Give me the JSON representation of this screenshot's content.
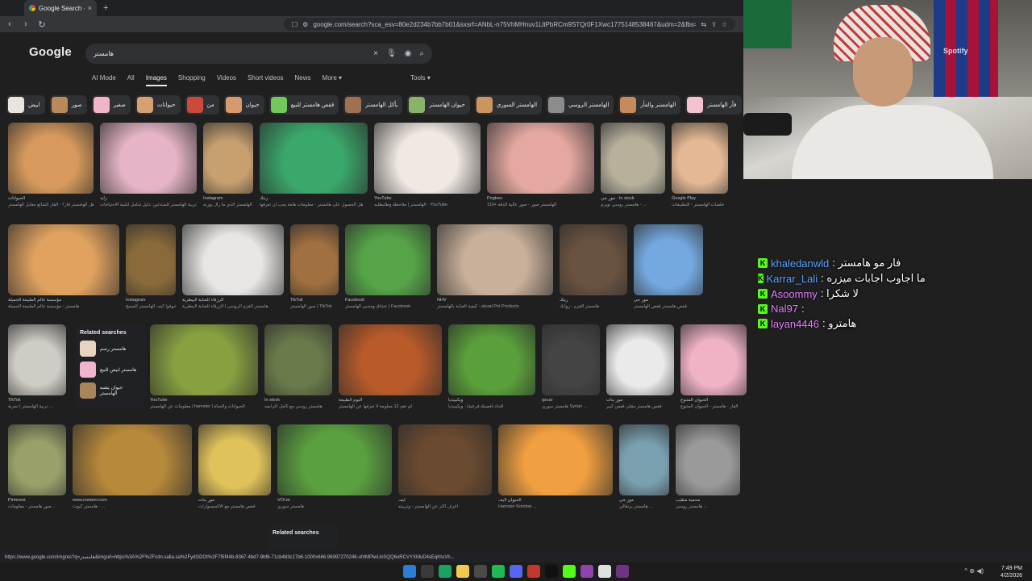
{
  "browser": {
    "tab_title": "Google Search - هامستر",
    "tab_close": "×",
    "new_tab": "+",
    "url": "google.com/search?sca_esv=80e2d234b7bb7b01&sxsrf=ANbL-n75VhMHnuv1LltPbRCm9STQr0F1Xwc1775148538467&udm=2&fbs=ADc_l-aN0..."
  },
  "google": {
    "logo": "Google",
    "query": "هامستر",
    "tabs": [
      "AI Mode",
      "All",
      "Images",
      "Shopping",
      "Videos",
      "Short videos",
      "News",
      "More ▾"
    ],
    "active_tab": "Images",
    "tools": "Tools ▾"
  },
  "chips": [
    {
      "label": "ابيض",
      "color": "#e9e4dc"
    },
    {
      "label": "صور",
      "color": "#b88a5a"
    },
    {
      "label": "صغير",
      "color": "#f1b5c8"
    },
    {
      "label": "حيوانات",
      "color": "#d8a070"
    },
    {
      "label": "من",
      "color": "#c94a3a"
    },
    {
      "label": "حيوان",
      "color": "#d79a6e"
    },
    {
      "label": "قفص هامستر للبيع",
      "color": "#71c95b"
    },
    {
      "label": "يأكل الهامستر",
      "color": "#a07050"
    },
    {
      "label": "حيوان الهامستر",
      "color": "#8ab368"
    },
    {
      "label": "الهامستر السوري",
      "color": "#c9965e"
    },
    {
      "label": "الهامستر الروسي",
      "color": "#8c8c8c"
    },
    {
      "label": "الهامستر والفأر",
      "color": "#c78a5a"
    },
    {
      "label": "فأر الهامستر",
      "color": "#f3c1cf"
    },
    {
      "label": "الهامستر",
      "color": "#8a6e4a"
    }
  ],
  "rows": [
    [
      {
        "src": "الحيوانات",
        "cap": "هل الهامستر فأر؟ - الفأر الشائع مقابل الهامستر",
        "color": "#d79a5c"
      },
      {
        "src": "زايد",
        "cap": "أسرار تربية الهامستر للمبتدئين: دليل شامل لتلبية الاحتياجات",
        "color": "#e6b4c6"
      },
      {
        "src": "Instagram",
        "cap": "الهامستر الذي ما زال يوزنه",
        "color": "#c8a070"
      },
      {
        "src": "زيتك",
        "cap": "هل الحصول على هامستر - معلومات هامة يجب أن تعرفها",
        "color": "#3aa86b"
      },
      {
        "src": "YouTube",
        "cap": "الهامستر | ملاحظة وطلبطلبه - YouTube",
        "color": "#f0e9e2"
      },
      {
        "src": "Pngtree",
        "cap": "110+ الهامستر صور - صور عالية الدقة",
        "color": "#e4a8a0"
      },
      {
        "src": "مور جي · In stock",
        "cap": "هامستر روسي نويرم - ...",
        "color": "#b7b19c"
      },
      {
        "src": "Google Play",
        "cap": "خلفيات الهامستر - التطبيقات",
        "color": "#e4b894"
      }
    ],
    [
      {
        "src": "مؤسسة عالم الطبيعة الجميلة",
        "cap": "هامستر - مؤسسة عالم الطبيعة الجميلة",
        "color": "#e0a25e"
      },
      {
        "src": "Instagram",
        "cap": "شوفوا كيف الهامستر المسح...",
        "color": "#8a6a3a"
      },
      {
        "src": "الرزقاء للعناية البيطرية",
        "cap": "هامستر القزم الروسي | الزرقاء للعناية البيطرية",
        "color": "#e8e6e4"
      },
      {
        "src": "TikTok",
        "cap": "صور الهامستر | TikTok",
        "color": "#a07040"
      },
      {
        "src": "Facebook",
        "cap": "عشاق ومحبي الهامستر | Facebook",
        "color": "#55a448"
      },
      {
        "src": "NHV",
        "cap": "كيفية العناية بالهامستر - atural Pet Products",
        "color": "#c9b09a"
      },
      {
        "src": "زيتك",
        "cap": "هامستر القزم - زوابك",
        "color": "#6a5240"
      },
      {
        "src": "مور جي",
        "cap": "قفص هامستر قفص الهامستر",
        "color": "#74a9e0"
      }
    ],
    [
      {
        "src": "TikTok",
        "cap": "تربية الهامستر | تجربة ...",
        "color": "#cfcbc5"
      },
      {
        "src": "YouTube",
        "cap": "معلومات عن الهامستر | hamster | الحيوانات والحياة",
        "color": "#88a040"
      },
      {
        "src": "In stock",
        "cap": "هامستر روسي مع كامل أغراضه",
        "color": "#6a7a4a"
      },
      {
        "src": "البوم الطبيعة",
        "cap": "لم تقم 12 معلومة لا تعرفها عن الهامستر",
        "color": "#b85a2a"
      },
      {
        "src": "ويكيبيديا",
        "cap": "أقداد (فصيلة فرعية) - ويكيبيديا",
        "color": "#5aa03a"
      },
      {
        "src": "qscar",
        "cap": "هامستر سوري Syrian ...",
        "color": "#444"
      },
      {
        "src": "مور بنات",
        "cap": "قفص هامستر مقلي قفص كبير",
        "color": "#eaeaea"
      },
      {
        "src": "الحيوان المتنوع",
        "cap": "الفأر - هامستر - الحيوان المتنوع",
        "color": "#f0b3c6"
      }
    ],
    [
      {
        "src": "Pinterest",
        "cap": "صور هامستر - معلومات ...",
        "color": "#9aa06a"
      },
      {
        "src": "www.mstami.com",
        "cap": "هامستر كيوت - ...",
        "color": "#b7893a"
      },
      {
        "src": "مور بنات",
        "cap": "قفص هامستر مع الاكسسوارات",
        "color": "#e0c25a"
      },
      {
        "src": "VOI.id",
        "cap": "هامستر سوري",
        "color": "#5aa040"
      },
      {
        "src": "أيف",
        "cap": "اعرف أكثر عن الهامستر - وتربيته",
        "color": "#6a4a30"
      },
      {
        "src": "الحيوان لايف",
        "cap": "Hamster Kombat ...",
        "color": "#f0a040"
      },
      {
        "src": "مور جي",
        "cap": "هامستر برتقالي ...",
        "color": "#7aa0b0"
      },
      {
        "src": "محمية مطيب",
        "cap": "هامستر روسي ...",
        "color": "#9a9a9a"
      }
    ]
  ],
  "related": {
    "heading": "Related searches",
    "items": [
      {
        "label": "هامستر رسم",
        "color": "#e8d2c0"
      },
      {
        "label": "هامستر ابيض للبيع",
        "color": "#f0b5cc"
      },
      {
        "label": "حيوان يشبه الهامستر",
        "color": "#a8865a"
      }
    ],
    "heading2": "Related searches"
  },
  "webcam": {
    "brand": "Spotify"
  },
  "chat": [
    {
      "user": "khaledanwld",
      "text": ": فار مو هامستر",
      "pink": false
    },
    {
      "user": "Karrar_Lali",
      "text": ": ما اجاوب اجابات ميزره",
      "pink": false
    },
    {
      "user": "Asoommy",
      "text": ": لا شكرا",
      "pink": true
    },
    {
      "user": "Nal97",
      "text": ":",
      "pink": true
    },
    {
      "user": "layan4446",
      "text": ": هامترو",
      "pink": true
    }
  ],
  "status_url": "https://www.google.com/imgres?q=هامستر&imgurl=https%3A%2F%2Fcdn.salla.sa%2FydGDOt%2F7f5f44b-8367-4bd7-9bf6-71cb483c17b6-1000x666.96997270246-ufrlMPlwUoSQQ6oRCVYXMuD4sEqKtuVh...",
  "taskbar": {
    "time": "7:49 PM",
    "date": "4/2/2026",
    "tray": "^ ⊕ ◀)"
  }
}
